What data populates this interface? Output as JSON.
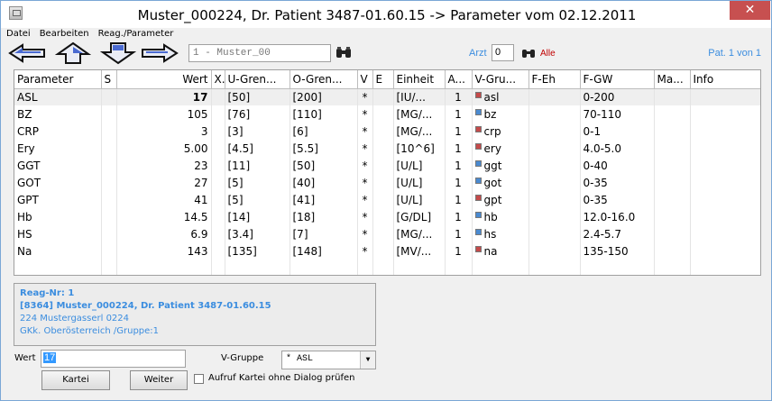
{
  "window": {
    "title": "Muster_000224, Dr. Patient 3487-01.60.15 -> Parameter vom 02.12.2011",
    "close_glyph": "✕"
  },
  "menu": [
    "Datei",
    "Bearbeiten",
    "Reag./Parameter"
  ],
  "toolbar": {
    "arrows": [
      "arrow-left-icon",
      "arrow-up-icon",
      "arrow-down-icon",
      "arrow-right-icon"
    ],
    "patient_field": "1 - Muster_00",
    "arzt_label": "Arzt",
    "arzt_value": "0",
    "alle_label": "Alle",
    "pat_count": "Pat. 1 von 1"
  },
  "grid": {
    "columns": [
      "Parameter",
      "S",
      "Wert",
      "X.",
      "U-Gren...",
      "O-Gren...",
      "V",
      "E",
      "Einheit",
      "A...",
      "V-Gru...",
      "F-Eh",
      "F-GW",
      "Ma...",
      "Info"
    ],
    "rows": [
      {
        "param": "ASL",
        "s": "",
        "wert": "17",
        "x": "",
        "u": "[50]",
        "o": "[200]",
        "v": "*",
        "e": "",
        "einheit": "[IU/...",
        "a": "1",
        "vgru": "asl",
        "feh": "",
        "fgw": "0-200",
        "ma": "",
        "info": "",
        "icon": "red"
      },
      {
        "param": "BZ",
        "s": "",
        "wert": "105",
        "x": "",
        "u": "[76]",
        "o": "[110]",
        "v": "*",
        "e": "",
        "einheit": "[MG/...",
        "a": "1",
        "vgru": "bz",
        "feh": "",
        "fgw": "70-110",
        "ma": "",
        "info": "",
        "icon": "blue"
      },
      {
        "param": "CRP",
        "s": "",
        "wert": "3",
        "x": "",
        "u": "[3]",
        "o": "[6]",
        "v": "*",
        "e": "",
        "einheit": "[MG/...",
        "a": "1",
        "vgru": "crp",
        "feh": "",
        "fgw": "0-1",
        "ma": "",
        "info": "",
        "icon": "red"
      },
      {
        "param": "Ery",
        "s": "",
        "wert": "5.00",
        "x": "",
        "u": "[4.5]",
        "o": "[5.5]",
        "v": "*",
        "e": "",
        "einheit": "[10^6]",
        "a": "1",
        "vgru": "ery",
        "feh": "",
        "fgw": "4.0-5.0",
        "ma": "",
        "info": "",
        "icon": "red"
      },
      {
        "param": "GGT",
        "s": "",
        "wert": "23",
        "x": "",
        "u": "[11]",
        "o": "[50]",
        "v": "*",
        "e": "",
        "einheit": "[U/L]",
        "a": "1",
        "vgru": "ggt",
        "feh": "",
        "fgw": "0-40",
        "ma": "",
        "info": "",
        "icon": "blue"
      },
      {
        "param": "GOT",
        "s": "",
        "wert": "27",
        "x": "",
        "u": "[5]",
        "o": "[40]",
        "v": "*",
        "e": "",
        "einheit": "[U/L]",
        "a": "1",
        "vgru": "got",
        "feh": "",
        "fgw": "0-35",
        "ma": "",
        "info": "",
        "icon": "blue"
      },
      {
        "param": "GPT",
        "s": "",
        "wert": "41",
        "x": "",
        "u": "[5]",
        "o": "[41]",
        "v": "*",
        "e": "",
        "einheit": "[U/L]",
        "a": "1",
        "vgru": "gpt",
        "feh": "",
        "fgw": "0-35",
        "ma": "",
        "info": "",
        "icon": "red"
      },
      {
        "param": "Hb",
        "s": "",
        "wert": "14.5",
        "x": "",
        "u": "[14]",
        "o": "[18]",
        "v": "*",
        "e": "",
        "einheit": "[G/DL]",
        "a": "1",
        "vgru": "hb",
        "feh": "",
        "fgw": "12.0-16.0",
        "ma": "",
        "info": "",
        "icon": "blue"
      },
      {
        "param": "HS",
        "s": "",
        "wert": "6.9",
        "x": "",
        "u": "[3.4]",
        "o": "[7]",
        "v": "*",
        "e": "",
        "einheit": "[MG/...",
        "a": "1",
        "vgru": "hs",
        "feh": "",
        "fgw": "2.4-5.7",
        "ma": "",
        "info": "",
        "icon": "blue"
      },
      {
        "param": "Na",
        "s": "",
        "wert": "143",
        "x": "",
        "u": "[135]",
        "o": "[148]",
        "v": "*",
        "e": "",
        "einheit": "[MV/...",
        "a": "1",
        "vgru": "na",
        "feh": "",
        "fgw": "135-150",
        "ma": "",
        "info": "",
        "icon": "red"
      }
    ],
    "selected_row": 0
  },
  "info_panel": {
    "line1": "Reag-Nr: 1",
    "line2": "[8364] Muster_000224, Dr. Patient 3487-01.60.15",
    "line3": "224 Mustergasserl 0224",
    "line4": "GKk. Oberösterreich /Gruppe:1"
  },
  "form": {
    "wert_label": "Wert",
    "wert_value": "17",
    "vgruppe_label": "V-Gruppe",
    "vgruppe_value": "* ASL",
    "kartei_label": "Kartei",
    "weiter_label": "Weiter",
    "checkbox_label": "Aufruf Kartei ohne Dialog prüfen"
  },
  "colors": {
    "accent_blue": "#3b8ddf",
    "close_red": "#c75050",
    "alle_red": "#c00000",
    "icon_red": "#c44a4a",
    "icon_blue": "#4a8ad0"
  }
}
